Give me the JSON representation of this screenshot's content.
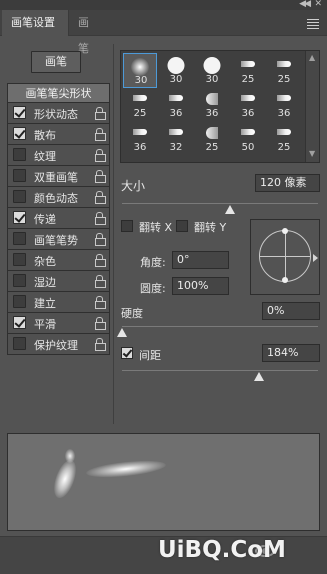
{
  "tabs": [
    {
      "label": "画笔设置"
    },
    {
      "label": "画笔"
    }
  ],
  "brush_presets_button": "画笔",
  "brush_tip_shape_label": "画笔笔尖形状",
  "options": [
    {
      "label": "形状动态",
      "checked": true
    },
    {
      "label": "散布",
      "checked": true
    },
    {
      "label": "纹理",
      "checked": false
    },
    {
      "label": "双重画笔",
      "checked": false
    },
    {
      "label": "颜色动态",
      "checked": false
    },
    {
      "label": "传递",
      "checked": true
    },
    {
      "label": "画笔笔势",
      "checked": false
    },
    {
      "label": "杂色",
      "checked": false
    },
    {
      "label": "湿边",
      "checked": false
    },
    {
      "label": "建立",
      "checked": false
    },
    {
      "label": "平滑",
      "checked": true
    },
    {
      "label": "保护纹理",
      "checked": false
    }
  ],
  "brush_tips": [
    {
      "size": "30",
      "shape": "soft"
    },
    {
      "size": "30",
      "shape": "hard"
    },
    {
      "size": "30",
      "shape": "hard"
    },
    {
      "size": "25",
      "shape": "tip"
    },
    {
      "size": "25",
      "shape": "tip"
    },
    {
      "size": "25",
      "shape": "tip"
    },
    {
      "size": "36",
      "shape": "tip"
    },
    {
      "size": "36",
      "shape": "fan"
    },
    {
      "size": "36",
      "shape": "tip"
    },
    {
      "size": "36",
      "shape": "tip"
    },
    {
      "size": "36",
      "shape": "tip"
    },
    {
      "size": "32",
      "shape": "tip"
    },
    {
      "size": "25",
      "shape": "fan"
    },
    {
      "size": "50",
      "shape": "tip"
    },
    {
      "size": "25",
      "shape": "tip"
    },
    {
      "size": "",
      "shape": "tip"
    },
    {
      "size": "",
      "shape": "tip"
    },
    {
      "size": "",
      "shape": "tip"
    },
    {
      "size": "",
      "shape": "tip"
    },
    {
      "size": "",
      "shape": "tip"
    }
  ],
  "size": {
    "label": "大小",
    "value": "120 像素",
    "slider_fraction": 0.55
  },
  "flip_x": {
    "label": "翻转",
    "axis": "X",
    "checked": false
  },
  "flip_y": {
    "label": "翻转",
    "axis": "Y",
    "checked": false
  },
  "angle": {
    "label": "角度:",
    "value": "0°"
  },
  "roundness": {
    "label": "圆度:",
    "value": "100%"
  },
  "hardness": {
    "label": "硬度",
    "value": "0%",
    "slider_fraction": 0.0
  },
  "spacing": {
    "label": "间距",
    "value": "184%",
    "checked": true,
    "slider_fraction": 0.7
  },
  "watermark": "UiBQ.CoM",
  "colors": {
    "panel": "#535353",
    "selected_border": "#4d9ad8"
  }
}
